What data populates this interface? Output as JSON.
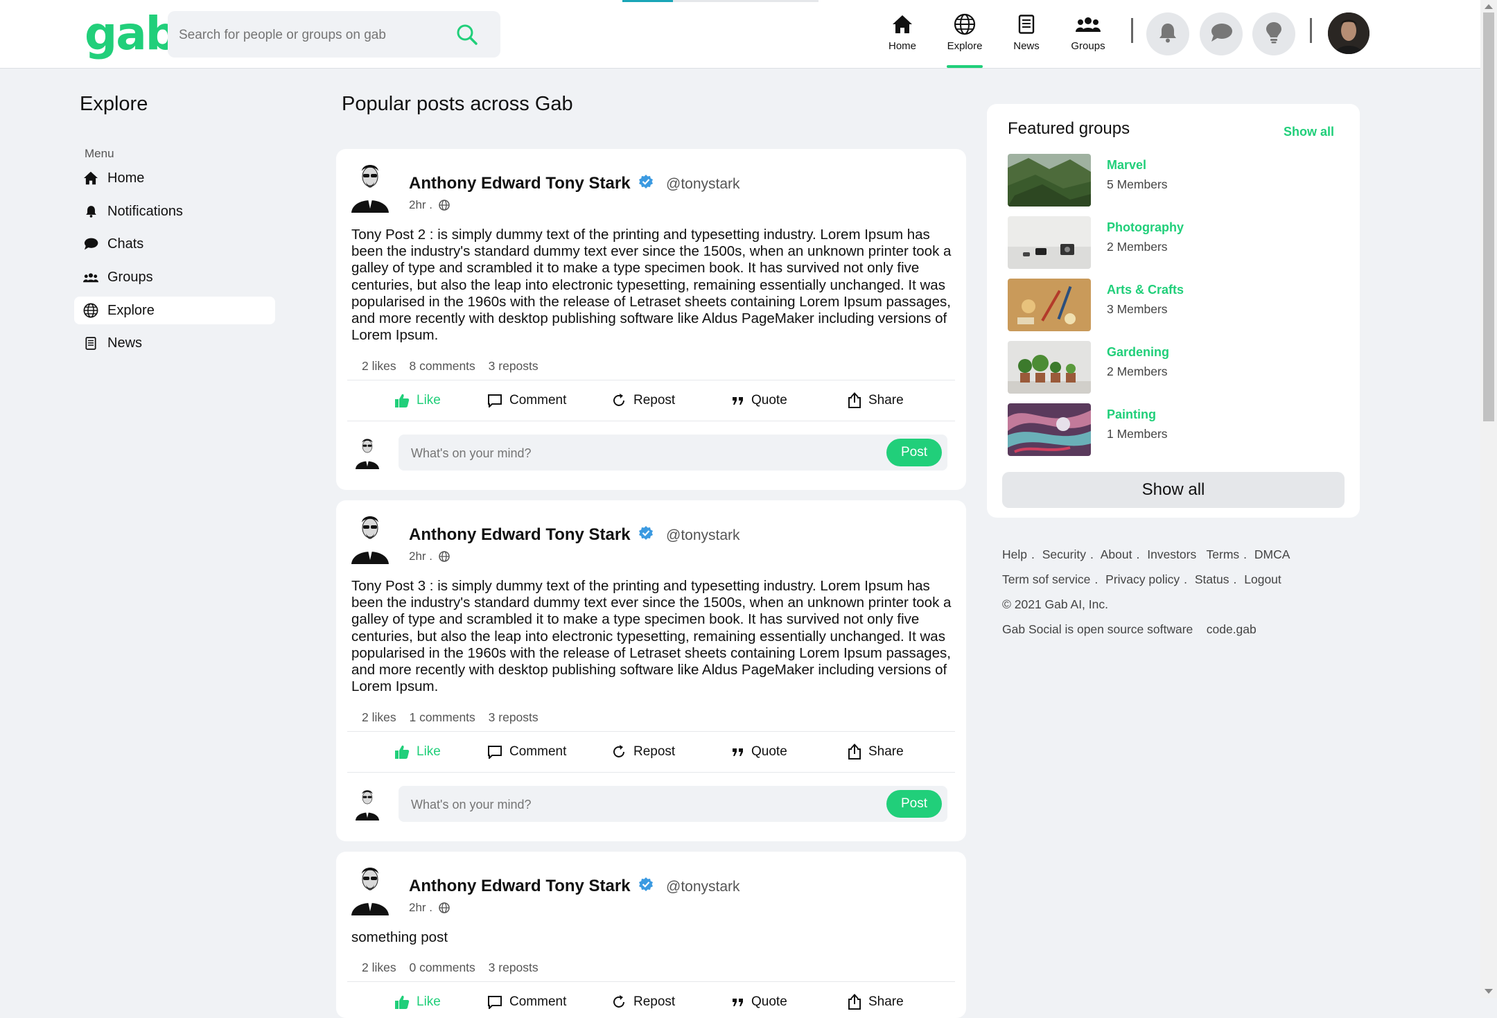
{
  "header": {
    "logo": "gab",
    "search_placeholder": "Search for people or groups on gab",
    "nav": [
      {
        "label": "Home"
      },
      {
        "label": "Explore"
      },
      {
        "label": "News"
      },
      {
        "label": "Groups"
      }
    ]
  },
  "sidebar": {
    "title": "Explore",
    "menu_label": "Menu",
    "items": [
      {
        "label": "Home"
      },
      {
        "label": "Notifications"
      },
      {
        "label": "Chats"
      },
      {
        "label": "Groups"
      },
      {
        "label": "Explore"
      },
      {
        "label": "News"
      }
    ]
  },
  "feed": {
    "title": "Popular posts across Gab",
    "composer_placeholder": "What's on your mind?",
    "post_button": "Post",
    "actions": {
      "like": "Like",
      "comment": "Comment",
      "repost": "Repost",
      "quote": "Quote",
      "share": "Share"
    },
    "posts": [
      {
        "author": "Anthony Edward Tony Stark",
        "handle": "@tonystark",
        "time": "2hr .",
        "body": "Tony Post 2 : is simply dummy text of the printing and typesetting industry. Lorem Ipsum has been the industry's standard dummy text ever since the 1500s, when an unknown printer took a galley of type and scrambled it to make a type specimen book. It has survived not only five centuries, but also the leap into electronic typesetting, remaining essentially unchanged. It was popularised in the 1960s with the release of Letraset sheets containing Lorem Ipsum passages, and more recently with desktop publishing software like Aldus PageMaker including versions of Lorem Ipsum.",
        "likes": "2 likes",
        "comments": "8 comments",
        "reposts": "3 reposts"
      },
      {
        "author": "Anthony Edward Tony Stark",
        "handle": "@tonystark",
        "time": "2hr .",
        "body": "Tony Post 3 : is simply dummy text of the printing and typesetting industry. Lorem Ipsum has been the industry's standard dummy text ever since the 1500s, when an unknown printer took a galley of type and scrambled it to make a type specimen book. It has survived not only five centuries, but also the leap into electronic typesetting, remaining essentially unchanged. It was popularised in the 1960s with the release of Letraset sheets containing Lorem Ipsum passages, and more recently with desktop publishing software like Aldus PageMaker including versions of Lorem Ipsum.",
        "likes": "2 likes",
        "comments": "1 comments",
        "reposts": "3 reposts"
      },
      {
        "author": "Anthony Edward Tony Stark",
        "handle": "@tonystark",
        "time": "2hr .",
        "body": "something post",
        "likes": "2 likes",
        "comments": "0 comments",
        "reposts": "3 reposts"
      }
    ]
  },
  "featured": {
    "title": "Featured groups",
    "show_all_link": "Show all",
    "show_all_button": "Show all",
    "groups": [
      {
        "name": "Marvel",
        "members": "5 Members"
      },
      {
        "name": "Photography",
        "members": "2 Members"
      },
      {
        "name": "Arts & Crafts",
        "members": "3 Members"
      },
      {
        "name": "Gardening",
        "members": "2 Members"
      },
      {
        "name": "Painting",
        "members": "1 Members"
      }
    ]
  },
  "footer": {
    "links": [
      "Help",
      "Security",
      "About",
      "Investors",
      "Terms",
      "DMCA",
      "Term sof service",
      "Privacy policy",
      "Status",
      "Logout"
    ],
    "copyright": "© 2021 Gab AI, Inc.",
    "oss": "Gab Social is open source software",
    "code": "code.gab"
  },
  "colors": {
    "accent": "#21cf7a",
    "background": "#f0f2f5",
    "verified": "#3b9ae1"
  },
  "icons": [
    "search-icon",
    "home-icon",
    "globe-icon",
    "news-icon",
    "groups-icon",
    "bell-icon",
    "chat-icon",
    "lightbulb-icon",
    "verified-icon",
    "thumbs-up-icon",
    "comment-icon",
    "repost-icon",
    "quote-icon",
    "share-icon"
  ]
}
